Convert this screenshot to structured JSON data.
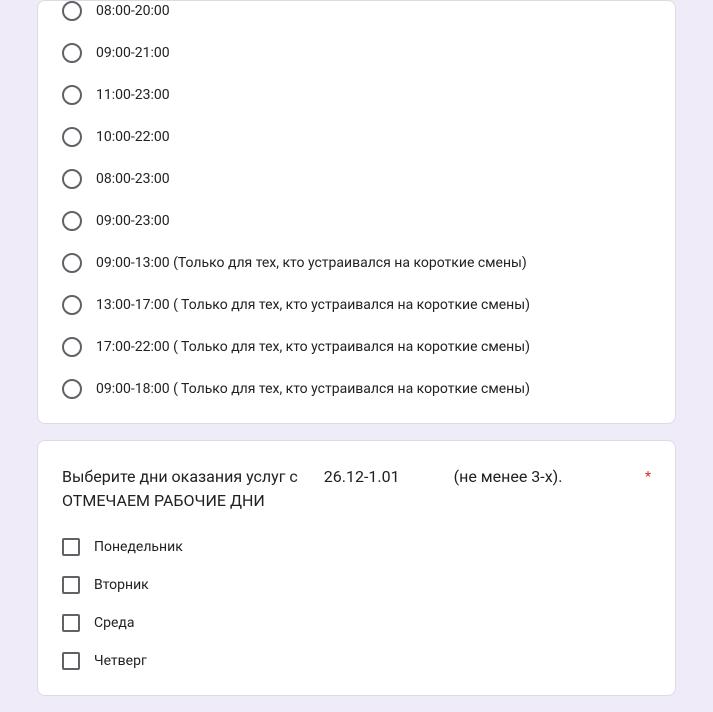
{
  "question1": {
    "options": [
      "08:00-20:00",
      "09:00-21:00",
      "11:00-23:00",
      "10:00-22:00",
      "08:00-23:00",
      "09:00-23:00",
      "09:00-13:00 (Только для тех, кто устраивался на короткие смены)",
      "13:00-17:00 ( Только для тех, кто устраивался на короткие смены)",
      "17:00-22:00 ( Только для тех, кто устраивался на короткие смены)",
      "09:00-18:00 ( Только для тех, кто устраивался на короткие смены)"
    ]
  },
  "question2": {
    "title_part1": "Выберите дни оказания услуг с",
    "title_part2": "26.12-1.01",
    "title_part3": "(не менее 3-х).",
    "title_line2": "ОТМЕЧАЕМ РАБОЧИЕ ДНИ",
    "required": "*",
    "options": [
      "Понедельник",
      "Вторник",
      "Среда",
      "Четверг"
    ]
  }
}
